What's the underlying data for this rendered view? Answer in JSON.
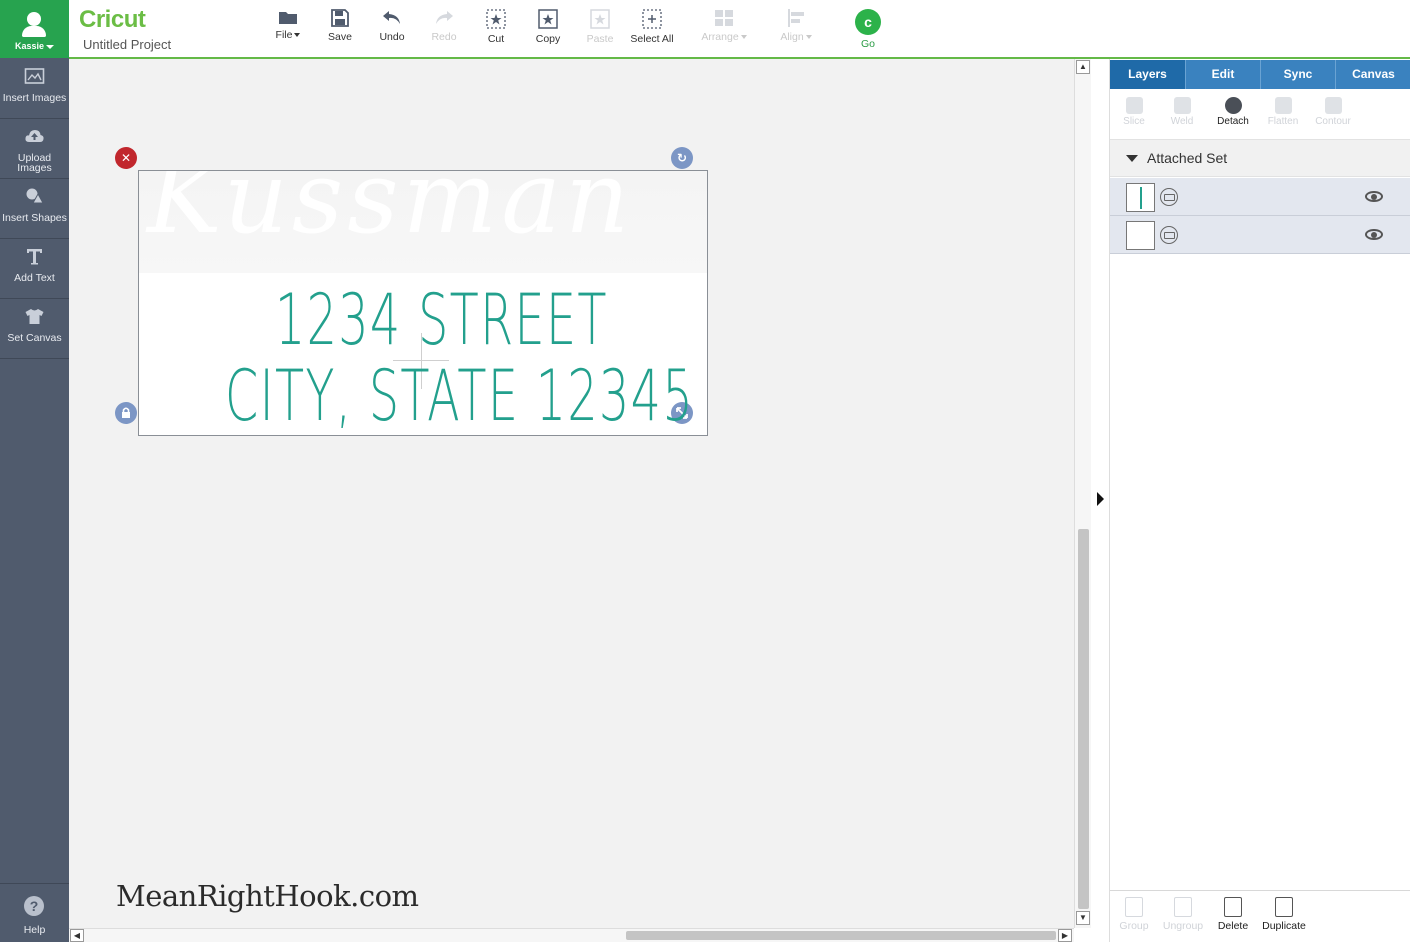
{
  "user": {
    "name": "Kassie"
  },
  "sidebar": {
    "items": [
      {
        "label": "Insert Images",
        "icon": "image-icon"
      },
      {
        "label": "Upload Images",
        "icon": "cloud-upload-icon"
      },
      {
        "label": "Insert Shapes",
        "icon": "shapes-icon"
      },
      {
        "label": "Add Text",
        "icon": "text-icon"
      },
      {
        "label": "Set Canvas",
        "icon": "shirt-icon"
      }
    ],
    "help_label": "Help"
  },
  "header": {
    "brand": "Cricut",
    "project_name": "Untitled Project"
  },
  "toolbar": {
    "file": "File",
    "save": "Save",
    "undo": "Undo",
    "redo": "Redo",
    "cut": "Cut",
    "copy": "Copy",
    "paste": "Paste",
    "select_all": "Select All",
    "arrange": "Arrange",
    "align": "Align",
    "go": "Go"
  },
  "canvas": {
    "ghost_name": "Kussman",
    "address_line1": "1234 STREET",
    "address_line2": "CITY, STATE 12345",
    "watermark": "MeanRightHook.com"
  },
  "panel": {
    "tabs": [
      "Layers",
      "Edit",
      "Sync",
      "Canvas"
    ],
    "active_tab": "Layers",
    "layer_tools": {
      "slice": "Slice",
      "weld": "Weld",
      "detach": "Detach",
      "flatten": "Flatten",
      "contour": "Contour"
    },
    "group_title": "Attached Set",
    "bottom_tools": {
      "group": "Group",
      "ungroup": "Ungroup",
      "delete": "Delete",
      "duplicate": "Duplicate"
    }
  },
  "colors": {
    "brand_green": "#6bbd45",
    "sidebar": "#505b6d",
    "panel_tab": "#3a82bf",
    "text_teal": "#23a08d",
    "delete_red": "#c1272d"
  }
}
